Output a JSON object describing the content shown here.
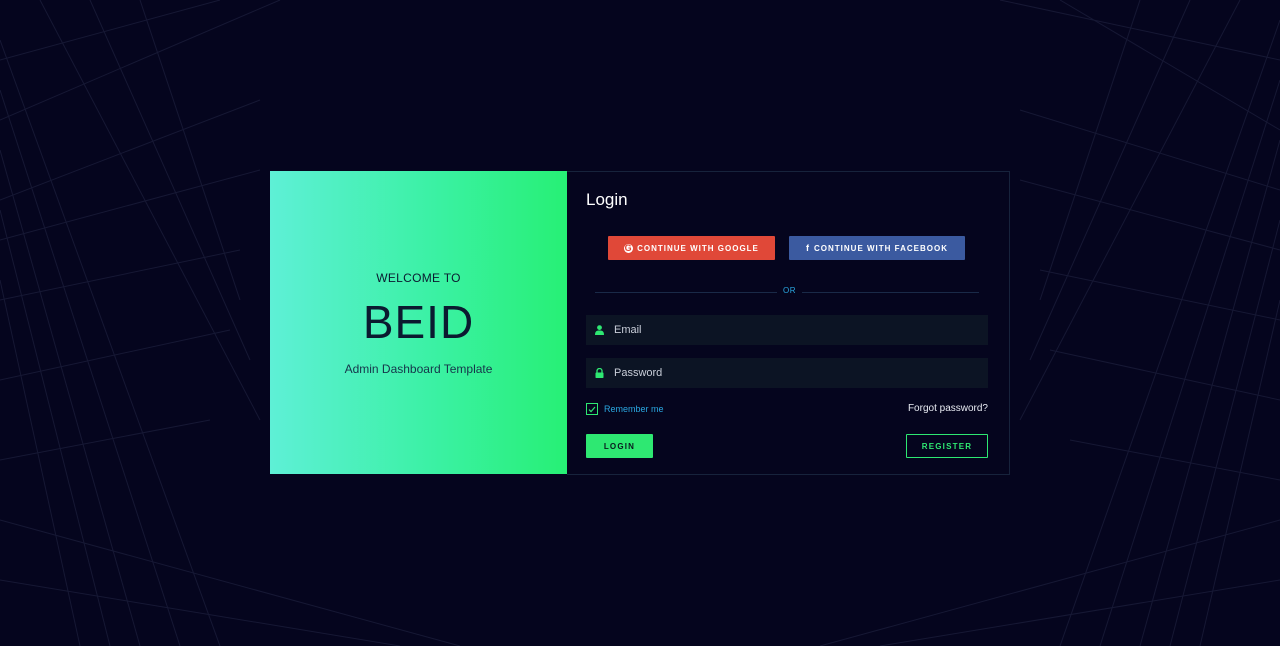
{
  "brand": {
    "welcome": "WELCOME TO",
    "name": "BEID",
    "tagline": "Admin Dashboard Template"
  },
  "form": {
    "title": "Login",
    "google_label": "CONTINUE WITH GOOGLE",
    "facebook_label": "CONTINUE WITH FACEBOOK",
    "or_label": "OR",
    "email_placeholder": "Email",
    "password_placeholder": "Password",
    "remember_label": "Remember me",
    "remember_checked": true,
    "forgot_label": "Forgot password?",
    "login_label": "LOGIN",
    "register_label": "REGISTER"
  },
  "icons": {
    "google": "google-icon",
    "facebook": "facebook-icon",
    "email": "user-icon",
    "password": "lock-icon",
    "checkbox": "check-icon"
  },
  "colors": {
    "background": "#05051e",
    "accent": "#2ee872",
    "google": "#e04838",
    "facebook": "#3b5aa0",
    "link": "#2aa7e0",
    "input_bg": "#0c1424"
  }
}
